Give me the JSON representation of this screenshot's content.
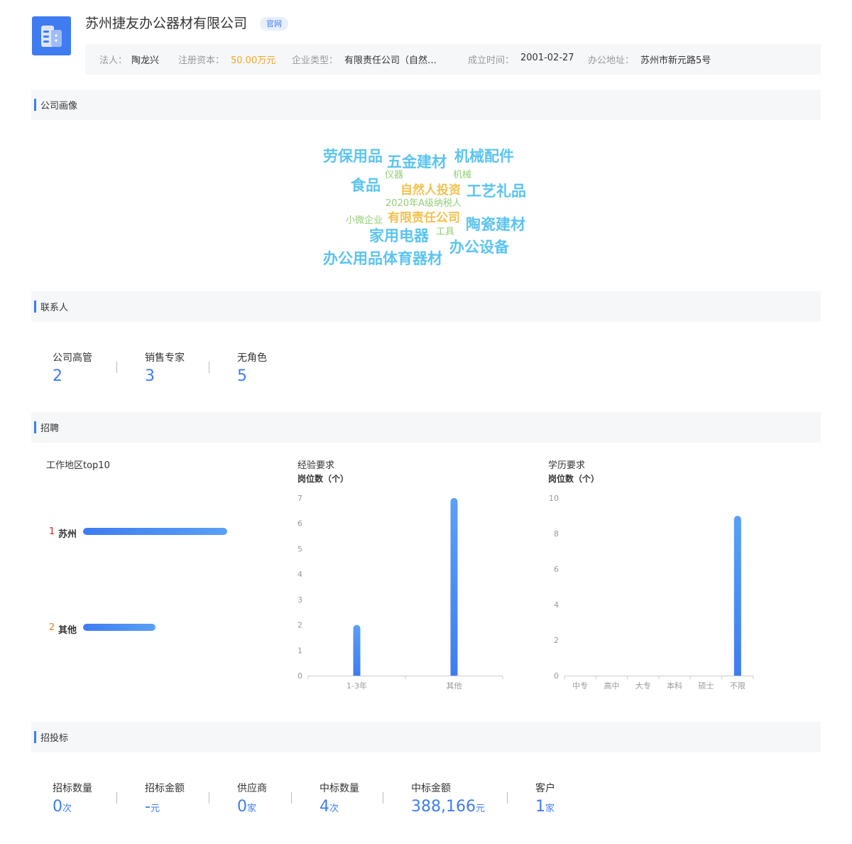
{
  "company": {
    "name": "苏州捷友办公器材有限公司",
    "official_tag": "官网",
    "info": [
      {
        "key": "法人：",
        "value": "陶龙兴"
      },
      {
        "key": "注册资本：",
        "value": "50.00万元"
      },
      {
        "key": "企业类型：",
        "value": "有限责任公司（自然…"
      },
      {
        "key": "成立时间：",
        "value": "2001-02-27"
      },
      {
        "key": "办公地址：",
        "value": "苏州市新元路5号"
      }
    ]
  },
  "sections": {
    "portrait": "公司画像",
    "contacts": "联系人",
    "recruit": "招聘",
    "bidding": "招投标"
  },
  "word_cloud": [
    "劳保用品",
    "五金建材",
    "机械配件",
    "仪器",
    "机械",
    "食品",
    "自然人投资",
    "工艺礼品",
    "2020年A级纳税人",
    "小微企业",
    "有限责任公司",
    "陶瓷建材",
    "家用电器",
    "工具",
    "办公设备",
    "办公用品体育器材"
  ],
  "contacts": [
    {
      "label": "公司高管",
      "value": "2"
    },
    {
      "label": "销售专家",
      "value": "3"
    },
    {
      "label": "无角色",
      "value": "5"
    }
  ],
  "recruit": {
    "region_title": "工作地区top10",
    "regions": [
      {
        "rank": "1",
        "name": "苏州",
        "share": 1.0,
        "color": "#e02020"
      },
      {
        "rank": "2",
        "name": "其他",
        "share": 0.5,
        "color": "#f07d1a"
      }
    ],
    "exp_title": "经验要求",
    "edu_title": "学历要求",
    "y_label": "岗位数（个）"
  },
  "chart_data": [
    {
      "type": "bar",
      "title": "经验要求",
      "ylabel": "岗位数（个）",
      "categories": [
        "1-3年",
        "其他"
      ],
      "values": [
        2,
        7
      ],
      "ylim": [
        0,
        7
      ],
      "yticks": [
        0,
        1,
        2,
        3,
        4,
        5,
        6,
        7
      ],
      "color": "#3f7cf2"
    },
    {
      "type": "bar",
      "title": "学历要求",
      "ylabel": "岗位数（个）",
      "categories": [
        "中专",
        "高中",
        "大专",
        "本科",
        "硕士",
        "不限"
      ],
      "values": [
        0,
        0,
        0,
        0,
        0,
        9
      ],
      "ylim": [
        0,
        10
      ],
      "yticks": [
        0,
        2,
        4,
        6,
        8,
        10
      ],
      "color": "#3f7cf2"
    }
  ],
  "bidding": [
    {
      "label": "招标数量",
      "value": "0",
      "unit": "次"
    },
    {
      "label": "招标金额",
      "value": "-",
      "unit": "元"
    },
    {
      "label": "供应商",
      "value": "0",
      "unit": "家"
    },
    {
      "label": "中标数量",
      "value": "4",
      "unit": "次"
    },
    {
      "label": "中标金额",
      "value": "388,166",
      "unit": "元"
    },
    {
      "label": "客户",
      "value": "1",
      "unit": "家"
    }
  ]
}
